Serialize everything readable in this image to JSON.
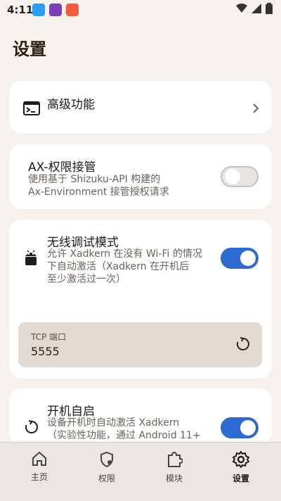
{
  "status_bar": {
    "time": "4:11"
  },
  "page": {
    "title": "设置"
  },
  "advanced": {
    "title": "高级功能"
  },
  "ax": {
    "title": "AX-权限接管",
    "subtitle_line1": "使用基于 Shizuku-API 构建的",
    "subtitle_line2": "Ax-Environment 接管授权请求",
    "enabled": false
  },
  "wireless": {
    "title": "无线调试模式",
    "subtitle_line1": "允许 Xadkern 在没有 Wi-Fi 的情况",
    "subtitle_line2": "下自动激活（Xadkern 在开机后",
    "subtitle_line3": "至少激活过一次）",
    "enabled": true,
    "tcp_label": "TCP 端口",
    "tcp_value": "5555"
  },
  "autostart": {
    "title": "开机自启",
    "subtitle_line1": "设备开机时自动激活 Xadkern",
    "subtitle_line2": "（实验性功能，通过 Android 11+",
    "enabled": true
  },
  "nav": {
    "items": [
      {
        "label": "主页",
        "icon": "home-icon"
      },
      {
        "label": "权限",
        "icon": "shield-icon"
      },
      {
        "label": "模块",
        "icon": "puzzle-icon"
      },
      {
        "label": "设置",
        "icon": "gear-icon"
      }
    ],
    "active": "设置"
  },
  "colors": {
    "accent": "#2d6bd3",
    "background": "#f7f1ed",
    "card": "#ffffff",
    "input_bg": "#e1d9d3"
  }
}
